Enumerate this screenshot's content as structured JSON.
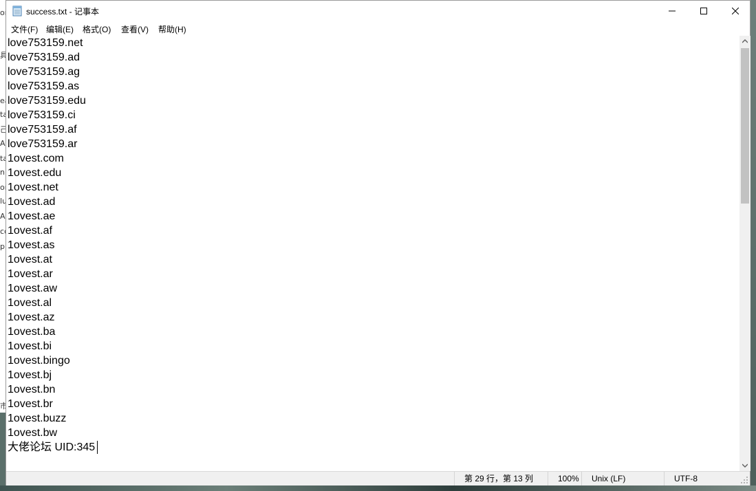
{
  "window": {
    "title": "success.txt - 记事本"
  },
  "background": {
    "glyphs": [
      "on",
      "具",
      "ea",
      "ta",
      "己",
      "A",
      "ta",
      "n",
      "or",
      "lu",
      "A",
      "cc",
      "p",
      "市"
    ]
  },
  "menu": [
    {
      "label": "文件(F)"
    },
    {
      "label": "编辑(E)"
    },
    {
      "label": "格式(O)"
    },
    {
      "label": "查看(V)"
    },
    {
      "label": "帮助(H)"
    }
  ],
  "editor": {
    "lines": [
      "love753159.net",
      "love753159.ad",
      "love753159.ag",
      "love753159.as",
      "love753159.edu",
      "love753159.ci",
      "love753159.af",
      "love753159.ar",
      "1ovest.com",
      "1ovest.edu",
      "1ovest.net",
      "1ovest.ad",
      "1ovest.ae",
      "1ovest.af",
      "1ovest.as",
      "1ovest.at",
      "1ovest.ar",
      "1ovest.aw",
      "1ovest.al",
      "1ovest.az",
      "1ovest.ba",
      "1ovest.bi",
      "1ovest.bingo",
      "1ovest.bj",
      "1ovest.bn",
      "1ovest.br",
      "1ovest.buzz",
      "1ovest.bw",
      "大佬论坛 UID:345"
    ]
  },
  "status": {
    "position": "第 29 行，第 13 列",
    "zoom": "100%",
    "line_ending": "Unix (LF)",
    "encoding": "UTF-8"
  },
  "colors": {
    "window_bg": "#ffffff",
    "status_bg": "#f0f0f0",
    "scroll_thumb": "#c2c2c2"
  },
  "icons": [
    "notepad-icon",
    "minimize-icon",
    "maximize-icon",
    "close-icon",
    "scroll-up-icon",
    "scroll-down-icon",
    "resize-grip-icon"
  ]
}
